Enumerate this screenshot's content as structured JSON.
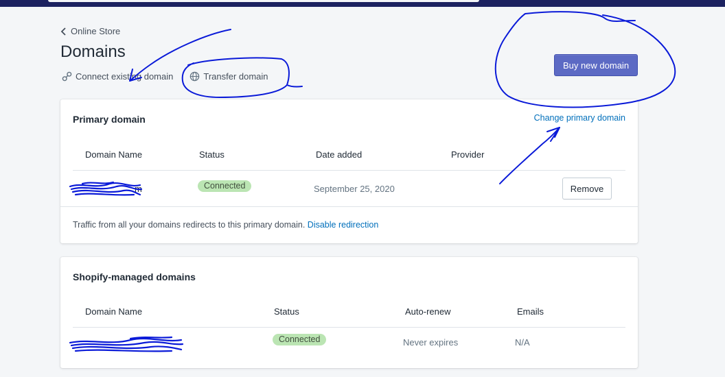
{
  "breadcrumb": {
    "label": "Online Store"
  },
  "page": {
    "title": "Domains"
  },
  "actions": {
    "connect_label": "Connect existing domain",
    "transfer_label": "Transfer domain"
  },
  "buy_button_label": "Buy new domain",
  "primary_card": {
    "title": "Primary domain",
    "change_link": "Change primary domain",
    "columns": [
      "Domain Name",
      "Status",
      "Date added",
      "Provider"
    ],
    "row": {
      "domain_visible_suffix": "m",
      "status": "Connected",
      "date_added": "September 25, 2020",
      "provider": "",
      "remove_label": "Remove"
    },
    "footer_text": "Traffic from all your domains redirects to this primary domain.",
    "footer_link": "Disable redirection"
  },
  "managed_card": {
    "title": "Shopify-managed domains",
    "columns": [
      "Domain Name",
      "Status",
      "Auto-renew",
      "Emails"
    ],
    "row": {
      "status": "Connected",
      "auto_renew": "Never expires",
      "emails": "N/A"
    }
  },
  "colors": {
    "primary_button": "#5c6ac4",
    "link": "#006fbb",
    "badge_success": "#bbe5b3",
    "top_bar": "#1c2260",
    "annotation_ink": "#0a1ad8"
  }
}
